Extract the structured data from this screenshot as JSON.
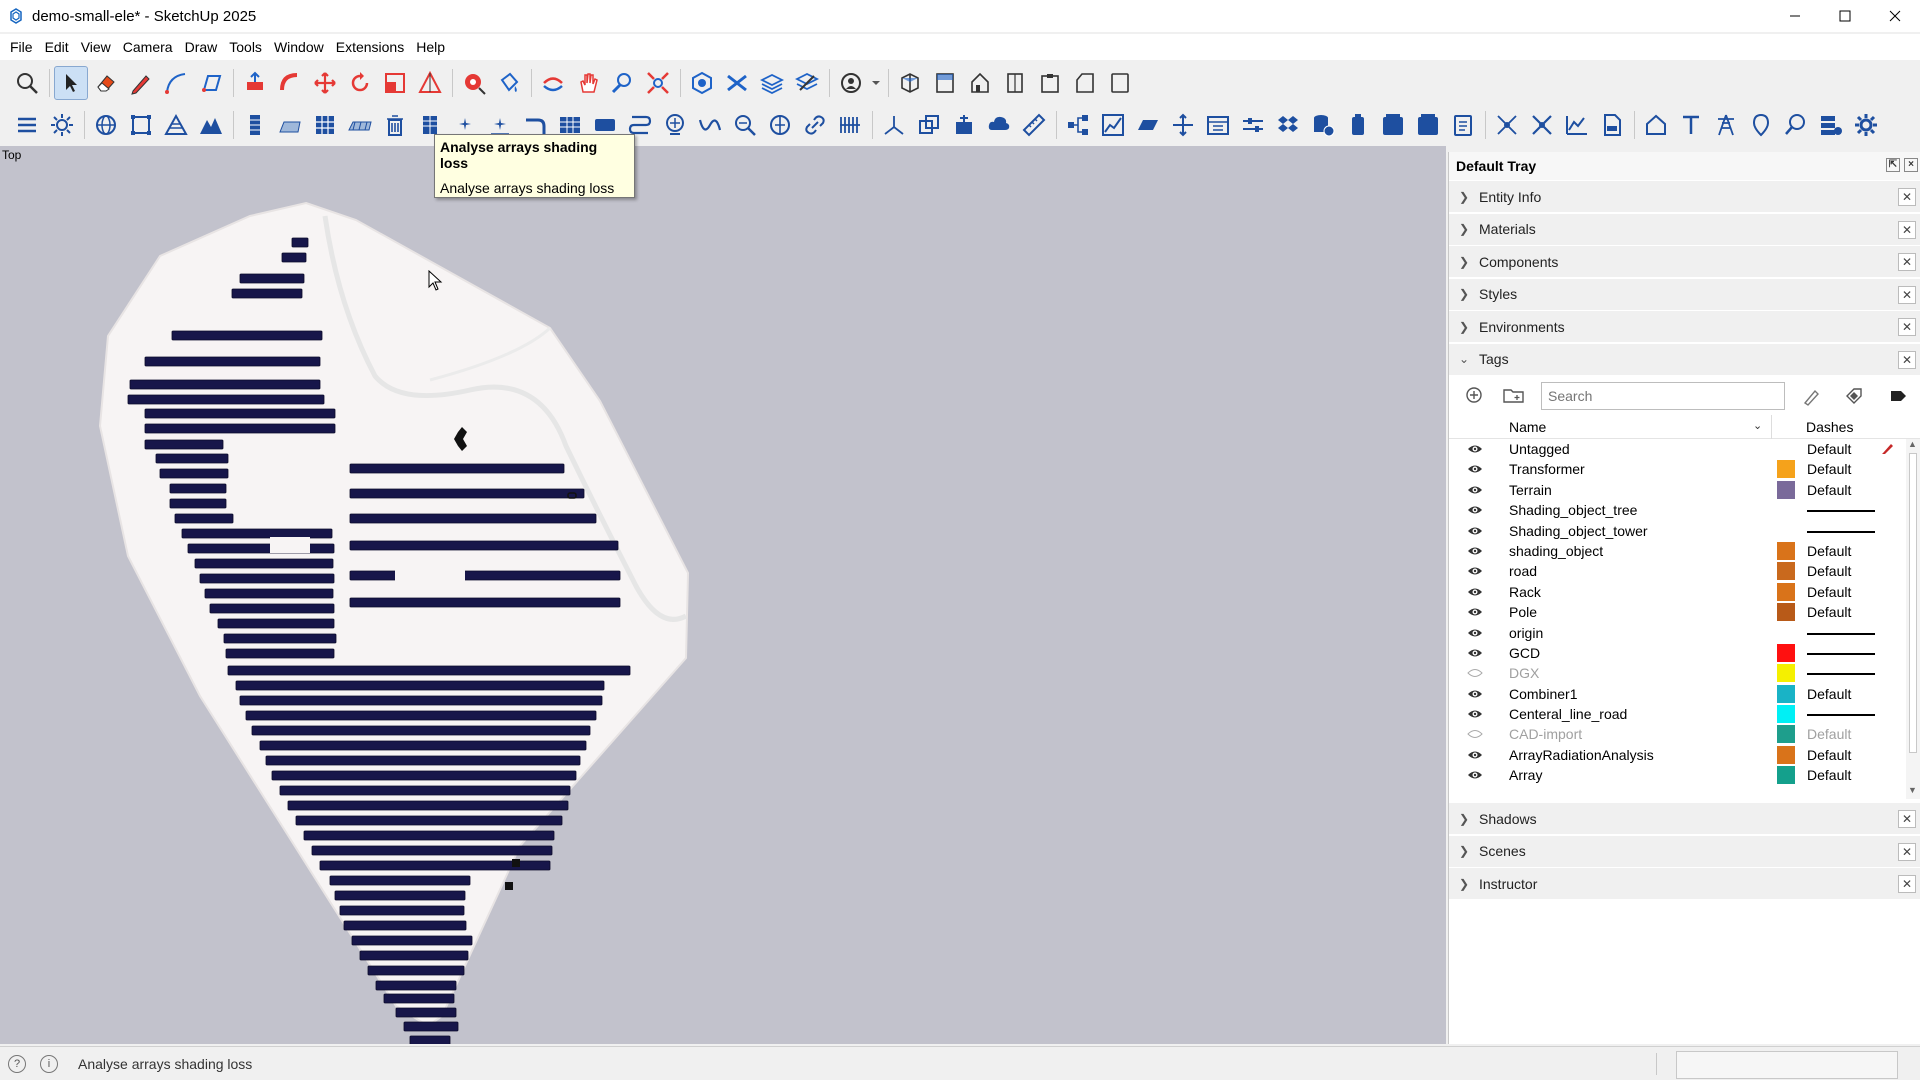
{
  "window": {
    "title": "demo-small-ele* - SketchUp 2025"
  },
  "menu": [
    "File",
    "Edit",
    "View",
    "Camera",
    "Draw",
    "Tools",
    "Window",
    "Extensions",
    "Help"
  ],
  "viewport": {
    "view_label": "Top"
  },
  "tooltip": {
    "title": "Analyse arrays shading loss",
    "body": "Analyse arrays shading loss"
  },
  "tray": {
    "title": "Default Tray",
    "panels_top": [
      "Entity Info",
      "Materials",
      "Components",
      "Styles",
      "Environments"
    ],
    "tags_panel": "Tags",
    "panels_bottom": [
      "Shadows",
      "Scenes",
      "Instructor"
    ],
    "search_placeholder": "Search",
    "col_name": "Name",
    "col_dashes": "Dashes",
    "tags": [
      {
        "name": "Untagged",
        "visible": true,
        "color": "",
        "dashes": "Default"
      },
      {
        "name": "Transformer",
        "visible": true,
        "color": "#f5a21b",
        "dashes": "Default"
      },
      {
        "name": "Terrain",
        "visible": true,
        "color": "#7a6a9a",
        "dashes": "Default"
      },
      {
        "name": "Shading_object_tree",
        "visible": true,
        "color": "",
        "dashes": ""
      },
      {
        "name": "Shading_object_tower",
        "visible": true,
        "color": "",
        "dashes": ""
      },
      {
        "name": "shading_object",
        "visible": true,
        "color": "#d9731a",
        "dashes": "Default"
      },
      {
        "name": "road",
        "visible": true,
        "color": "#c9691d",
        "dashes": "Default"
      },
      {
        "name": "Rack",
        "visible": true,
        "color": "#d9731a",
        "dashes": "Default"
      },
      {
        "name": "Pole",
        "visible": true,
        "color": "#b85a18",
        "dashes": "Default"
      },
      {
        "name": "origin",
        "visible": true,
        "color": "",
        "dashes": ""
      },
      {
        "name": "GCD",
        "visible": true,
        "color": "#ff1010",
        "dashes": ""
      },
      {
        "name": "DGX",
        "visible": false,
        "color": "#f5f000",
        "dashes": ""
      },
      {
        "name": "Combiner1",
        "visible": true,
        "color": "#19b3c6",
        "dashes": "Default"
      },
      {
        "name": "Centeral_line_road",
        "visible": true,
        "color": "#00f0f5",
        "dashes": ""
      },
      {
        "name": "CAD-import",
        "visible": false,
        "color": "#1e9e8c",
        "dashes": "Default"
      },
      {
        "name": "ArrayRadiationAnalysis",
        "visible": true,
        "color": "#d9731a",
        "dashes": "Default"
      },
      {
        "name": "Array",
        "visible": true,
        "color": "#14a08c",
        "dashes": "Default"
      }
    ]
  },
  "status": {
    "text": "Analyse arrays shading loss"
  },
  "colors": {
    "viewport_bg": "#c2c2cc",
    "terrain": "#f6f3f3",
    "panel_fill": "#17164a"
  }
}
